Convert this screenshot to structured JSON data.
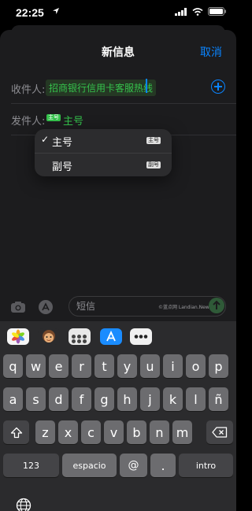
{
  "status_bar": {
    "time": "22:25"
  },
  "nav": {
    "title": "新信息",
    "cancel_label": "取消"
  },
  "recipient_row": {
    "label": "收件人:",
    "value": "招商银行信用卡客服热线"
  },
  "sender_row": {
    "label": "发件人:",
    "badge": "主号",
    "value": "主号"
  },
  "line_menu": {
    "items": [
      {
        "label": "主号",
        "badge": "主号",
        "checked": true
      },
      {
        "label": "副号",
        "badge": "副号",
        "checked": false
      }
    ]
  },
  "compose": {
    "placeholder": "短信",
    "watermark": "©蓝点网 Landian.News"
  },
  "app_strip": {
    "icons": [
      "photos-icon",
      "memoji-icon",
      "handwriting-icon",
      "app-store-icon",
      "more-icon"
    ]
  },
  "keyboard": {
    "row1": [
      "q",
      "w",
      "e",
      "r",
      "t",
      "y",
      "u",
      "i",
      "o",
      "p"
    ],
    "row2": [
      "a",
      "s",
      "d",
      "f",
      "g",
      "h",
      "j",
      "k",
      "l",
      "ñ"
    ],
    "row3": [
      "z",
      "x",
      "c",
      "v",
      "b",
      "n",
      "m"
    ],
    "numbers_label": "123",
    "space_label": "espacio",
    "at_label": "@",
    "period_label": ".",
    "return_label": "intro"
  },
  "colors": {
    "accent": "#0a84ff",
    "green": "#35c24c",
    "sheet": "#1c1c1e"
  }
}
